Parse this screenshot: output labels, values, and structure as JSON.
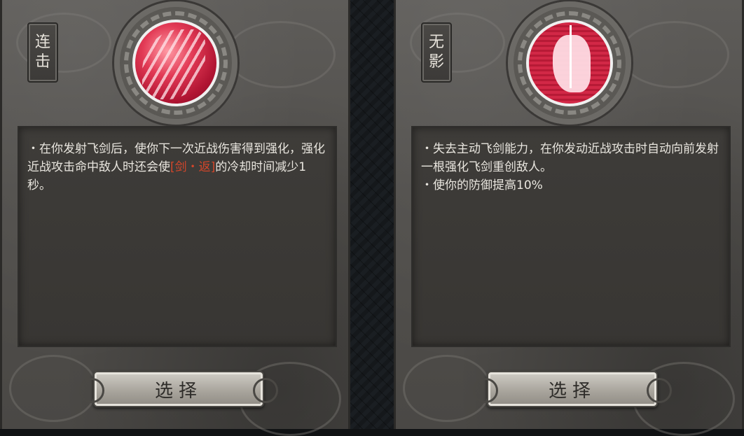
{
  "cards": [
    {
      "tag": [
        "连",
        "击"
      ],
      "icon": "sword-slash-icon",
      "lines": [
        {
          "pre": "・在你发射飞剑后，使你下一次近战伤害得到强化，强化近战攻击命中敌人时还会使",
          "highlight": "[剑・返]",
          "post": "的冷却时间减少1秒。"
        }
      ],
      "select_label": "选择"
    },
    {
      "tag": [
        "无",
        "影"
      ],
      "icon": "kneeling-swordsman-icon",
      "lines": [
        {
          "pre": "・失去主动飞剑能力，在你发动近战攻击时自动向前发射一根强化飞剑重创敌人。",
          "highlight": "",
          "post": ""
        },
        {
          "pre": "・使你的防御提高10%",
          "highlight": "",
          "post": ""
        }
      ],
      "select_label": "选择"
    }
  ],
  "colors": {
    "highlight": "#d4462a",
    "gem": "#e23a55"
  }
}
